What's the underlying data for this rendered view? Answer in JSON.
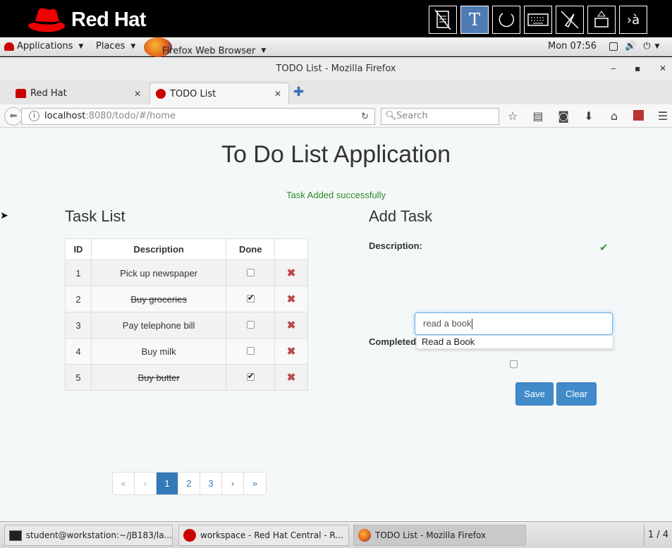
{
  "branding": {
    "logo_text": "Red Hat"
  },
  "toolbar_tools": [
    {
      "icon": "document-crossed-icon"
    },
    {
      "icon": "text-tool-icon",
      "label": "T"
    },
    {
      "icon": "circle-tool-icon"
    },
    {
      "icon": "keyboard-icon"
    },
    {
      "icon": "pointer-crossed-icon"
    },
    {
      "icon": "eject-icon"
    },
    {
      "icon": "input-method-icon",
      "label": "›à"
    }
  ],
  "panel": {
    "applications": "Applications",
    "places": "Places",
    "browser_app": "Firefox Web Browser",
    "clock": "Mon 07:56"
  },
  "window": {
    "title": "TODO List - Mozilla Firefox"
  },
  "tabs": [
    {
      "label": "Red Hat"
    },
    {
      "label": "TODO List"
    }
  ],
  "urlbar": {
    "host": "localhost",
    "path": ":8080/todo/#/home"
  },
  "search": {
    "placeholder": "Search"
  },
  "page": {
    "title": "To Do List Application",
    "flash": "Task Added successfully",
    "task_list_heading": "Task List",
    "add_task_heading": "Add Task",
    "table": {
      "headers": [
        "ID",
        "Description",
        "Done",
        ""
      ],
      "rows": [
        {
          "id": "1",
          "description": "Pick up newspaper",
          "done": false
        },
        {
          "id": "2",
          "description": "Buy groceries",
          "done": true
        },
        {
          "id": "3",
          "description": "Pay telephone bill",
          "done": false
        },
        {
          "id": "4",
          "description": "Buy milk",
          "done": false
        },
        {
          "id": "5",
          "description": "Buy butter",
          "done": true
        }
      ]
    },
    "pagination": {
      "items": [
        "«",
        "‹",
        "1",
        "2",
        "3",
        "›",
        "»"
      ],
      "current": "1"
    },
    "form": {
      "description_label": "Description:",
      "description_value": "read a book",
      "autocomplete_suggestion": "Read a Book",
      "completed_label": "Completed",
      "save_label": "Save",
      "clear_label": "Clear"
    }
  },
  "taskbar": {
    "items": [
      {
        "label": "student@workstation:~/JB183/la..."
      },
      {
        "label": "workspace - Red Hat Central - R..."
      },
      {
        "label": "TODO List - Mozilla Firefox"
      }
    ],
    "workspace": "1 / 4"
  }
}
